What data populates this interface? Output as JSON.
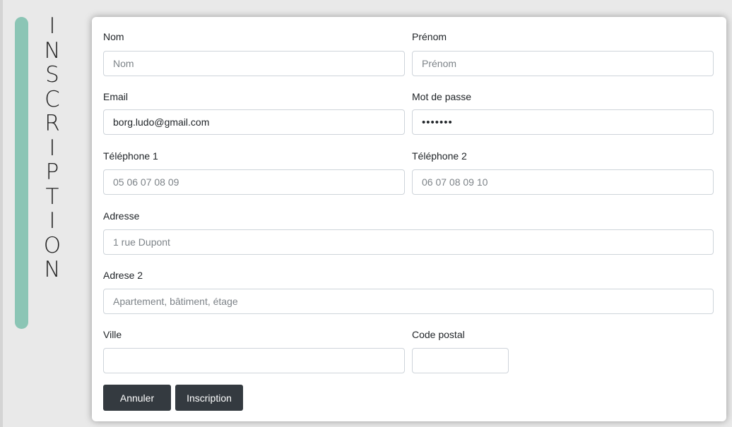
{
  "sidebar": {
    "title_letters": [
      "I",
      "N",
      "S",
      "C",
      "R",
      "I",
      "P",
      "T",
      "I",
      "O",
      "N"
    ],
    "accent_color": "#8bc5b5"
  },
  "form": {
    "nom": {
      "label": "Nom",
      "placeholder": "Nom",
      "value": ""
    },
    "prenom": {
      "label": "Prénom",
      "placeholder": "Prénom",
      "value": ""
    },
    "email": {
      "label": "Email",
      "placeholder": "",
      "value": "borg.ludo@gmail.com"
    },
    "password": {
      "label": "Mot de passe",
      "placeholder": "",
      "value": "1234567"
    },
    "tel1": {
      "label": "Téléphone 1",
      "placeholder": "05 06 07 08 09",
      "value": ""
    },
    "tel2": {
      "label": "Téléphone 2",
      "placeholder": "06 07 08 09 10",
      "value": ""
    },
    "adresse": {
      "label": "Adresse",
      "placeholder": "1 rue Dupont",
      "value": ""
    },
    "adresse2": {
      "label": "Adrese 2",
      "placeholder": "Apartement, bâtiment, étage",
      "value": ""
    },
    "ville": {
      "label": "Ville",
      "placeholder": "",
      "value": ""
    },
    "code_postal": {
      "label": "Code postal",
      "placeholder": "",
      "value": ""
    }
  },
  "buttons": {
    "cancel_label": "Annuler",
    "submit_label": "Inscription",
    "color": "#343a40"
  }
}
